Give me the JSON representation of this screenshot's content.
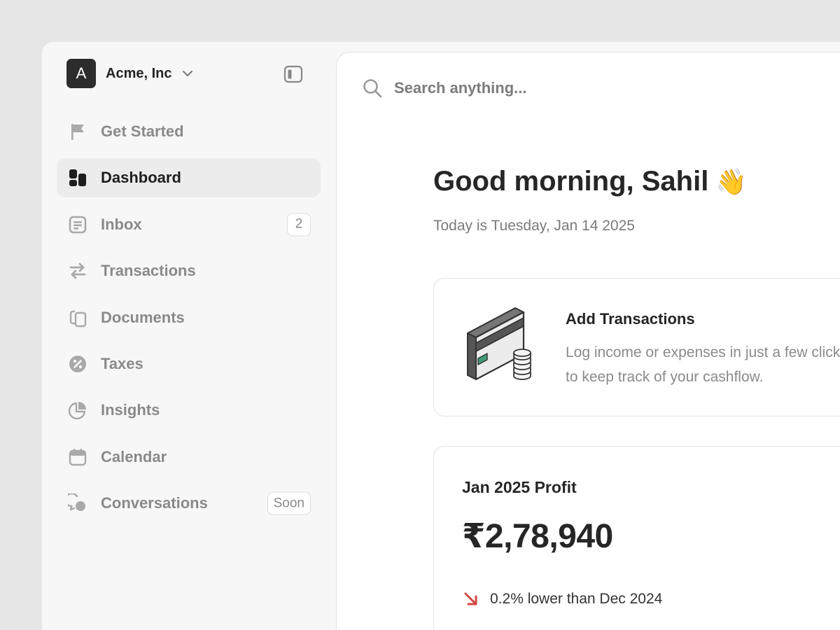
{
  "org": {
    "initial": "A",
    "name": "Acme, Inc"
  },
  "sidebar": {
    "items": [
      {
        "label": "Get Started",
        "icon": "flag-icon"
      },
      {
        "label": "Dashboard",
        "icon": "dashboard-icon",
        "active": true
      },
      {
        "label": "Inbox",
        "icon": "inbox-icon",
        "badge": "2"
      },
      {
        "label": "Transactions",
        "icon": "transactions-icon"
      },
      {
        "label": "Documents",
        "icon": "documents-icon"
      },
      {
        "label": "Taxes",
        "icon": "taxes-icon"
      },
      {
        "label": "Insights",
        "icon": "insights-icon"
      },
      {
        "label": "Calendar",
        "icon": "calendar-icon"
      },
      {
        "label": "Conversations",
        "icon": "conversations-icon",
        "badge": "Soon"
      }
    ]
  },
  "search": {
    "placeholder": "Search anything..."
  },
  "greeting": {
    "text": "Good morning, Sahil",
    "emoji": "👋",
    "date": "Today is Tuesday, Jan 14 2025"
  },
  "add_transactions": {
    "title": "Add Transactions",
    "description": "Log income or expenses in just a few clicks to keep track of your cashflow."
  },
  "profit": {
    "title": "Jan 2025 Profit",
    "value": "₹2,78,940",
    "change": "0.2% lower than Dec 2024"
  },
  "colors": {
    "trend_down": "#d64541",
    "card_accent": "#3f9a74",
    "active_bg": "#ececec"
  }
}
